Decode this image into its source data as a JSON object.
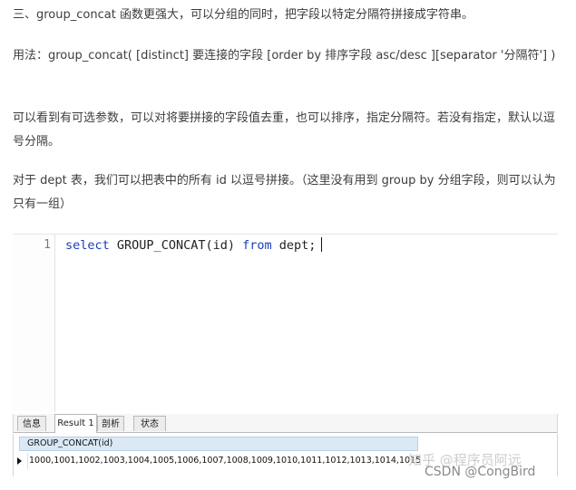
{
  "article": {
    "p1": "三、group_concat 函数更强大，可以分组的同时，把字段以特定分隔符拼接成字符串。",
    "p2": "用法：group_concat( [distinct] 要连接的字段 [order by 排序字段 asc/desc ][separator '分隔符'] )",
    "p3": "可以看到有可选参数，可以对将要拼接的字段值去重，也可以排序，指定分隔符。若没有指定，默认以逗号分隔。",
    "p4": "对于 dept 表，我们可以把表中的所有 id 以逗号拼接。（这里没有用到 group by 分组字段，则可以认为只有一组）"
  },
  "editor": {
    "line_number": "1",
    "code": {
      "kw_select": "select",
      "func": "GROUP_CONCAT(id)",
      "kw_from": "from",
      "rest": "dept;"
    }
  },
  "tabs": [
    {
      "label": "信息"
    },
    {
      "label": "Result 1"
    },
    {
      "label": "剖析"
    },
    {
      "label": "状态"
    }
  ],
  "result": {
    "column_header": "GROUP_CONCAT(id)",
    "row_value": "1000,1001,1002,1003,1004,1005,1006,1007,1008,1009,1010,1011,1012,1013,1014,1015"
  },
  "watermark": "知乎 @程序员阿远",
  "credit": "CSDN @CongBird"
}
